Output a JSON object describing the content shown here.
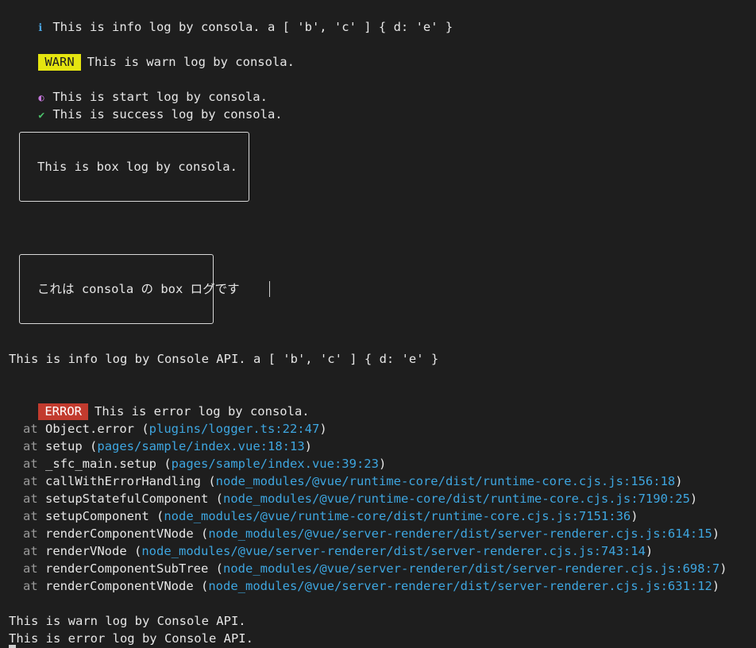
{
  "logs": {
    "info_consola": "This is info log by consola. a [ 'b', 'c' ] { d: 'e' }",
    "warn_badge": "WARN",
    "warn_consola": "This is warn log by consola.",
    "start_consola": "This is start log by consola.",
    "success_consola": "This is success log by consola.",
    "box_consola": "This is box log by consola.",
    "box_japanese": "これは consola の box ログです",
    "info_console_api": "This is info log by Console API. a [ 'b', 'c' ] { d: 'e' }",
    "error_badge": "ERROR",
    "error_consola": "This is error log by consola.",
    "warn_console_api": "This is warn log by Console API.",
    "error_console_api": "This is error log by Console API."
  },
  "icons": {
    "info": "ℹ",
    "start": "◐",
    "success": "✔"
  },
  "stack": {
    "at": "at",
    "frames": [
      {
        "fn": "Object.error",
        "loc": "plugins/logger.ts:22:47"
      },
      {
        "fn": "setup",
        "loc": "pages/sample/index.vue:18:13"
      },
      {
        "fn": "_sfc_main.setup",
        "loc": "pages/sample/index.vue:39:23"
      },
      {
        "fn": "callWithErrorHandling",
        "loc": "node_modules/@vue/runtime-core/dist/runtime-core.cjs.js:156:18"
      },
      {
        "fn": "setupStatefulComponent",
        "loc": "node_modules/@vue/runtime-core/dist/runtime-core.cjs.js:7190:25"
      },
      {
        "fn": "setupComponent",
        "loc": "node_modules/@vue/runtime-core/dist/runtime-core.cjs.js:7151:36"
      },
      {
        "fn": "renderComponentVNode",
        "loc": "node_modules/@vue/server-renderer/dist/server-renderer.cjs.js:614:15"
      },
      {
        "fn": "renderVNode",
        "loc": "node_modules/@vue/server-renderer/dist/server-renderer.cjs.js:743:14"
      },
      {
        "fn": "renderComponentSubTree",
        "loc": "node_modules/@vue/server-renderer/dist/server-renderer.cjs.js:698:7"
      },
      {
        "fn": "renderComponentVNode",
        "loc": "node_modules/@vue/server-renderer/dist/server-renderer.cjs.js:631:12"
      }
    ]
  },
  "colors": {
    "background": "#1e1e1e",
    "text": "#e6e6e6",
    "warn_badge": "#e5e510",
    "error_badge": "#c23b2e",
    "link": "#3ea6e0",
    "info_icon": "#4aa3df",
    "start_icon": "#c678dd",
    "success_icon": "#4cc36b"
  }
}
